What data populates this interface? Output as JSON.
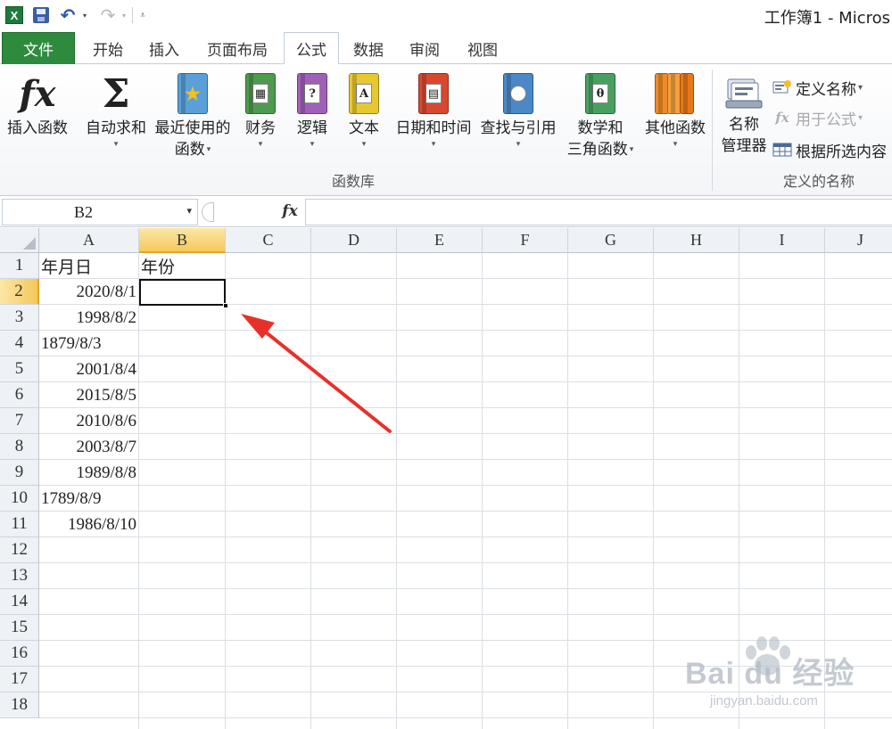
{
  "window": {
    "title": "工作簿1 - Micros"
  },
  "quick_access": {
    "app_icon": "excel-icon",
    "save_icon": "save-icon",
    "undo_icon": "undo-icon",
    "redo_icon": "redo-icon",
    "undo_glyph": "↶",
    "redo_glyph": "↷",
    "dd_glyph": "▾",
    "customize_glyph": "⩡",
    "app_glyph": "X"
  },
  "tabs": [
    {
      "label": "文件"
    },
    {
      "label": "开始"
    },
    {
      "label": "插入"
    },
    {
      "label": "页面布局"
    },
    {
      "label": "公式",
      "active": true
    },
    {
      "label": "数据"
    },
    {
      "label": "审阅"
    },
    {
      "label": "视图"
    }
  ],
  "ribbon": {
    "function_library": {
      "label": "函数库",
      "buttons": [
        {
          "label": "插入函数",
          "icon": "insert-function-icon",
          "glyph": "fx"
        },
        {
          "label": "自动求和",
          "icon": "sigma-icon",
          "glyph": "Σ"
        },
        {
          "label": "最近使用的",
          "label2": "函数",
          "icon": "recently-used-icon",
          "glyph": "★",
          "color": "#5aa0d8"
        },
        {
          "label": "财务",
          "icon": "financial-icon",
          "glyph": "▦",
          "color": "#4e9a4e"
        },
        {
          "label": "逻辑",
          "icon": "logical-icon",
          "glyph": "?",
          "color": "#a060b8"
        },
        {
          "label": "文本",
          "icon": "text-icon",
          "glyph": "A",
          "color": "#e8c830"
        },
        {
          "label": "日期和时间",
          "icon": "date-time-icon",
          "glyph": "▤",
          "color": "#d84830"
        },
        {
          "label": "查找与引用",
          "icon": "lookup-reference-icon",
          "glyph": "🔍",
          "color": "#4a88c8"
        },
        {
          "label": "数学和",
          "label2": "三角函数",
          "icon": "math-trig-icon",
          "glyph": "θ",
          "color": "#48a060"
        },
        {
          "label": "其他函数",
          "icon": "more-functions-icon",
          "glyph": "",
          "color": "#f08a28"
        }
      ],
      "caret": "▾"
    },
    "defined_names": {
      "label": "定义的名称",
      "name_manager": {
        "label": "名称",
        "label2": "管理器",
        "icon": "name-manager-icon"
      },
      "items": [
        {
          "label": "定义名称",
          "icon": "define-name-icon",
          "caret": "▾",
          "enabled": true
        },
        {
          "label": "用于公式",
          "icon": "use-in-formula-icon",
          "caret": "▾",
          "enabled": false
        },
        {
          "label": "根据所选内容",
          "icon": "create-from-selection-icon",
          "enabled": true
        }
      ]
    }
  },
  "formula_bar": {
    "name_box": "B2",
    "fx_label": "fx",
    "formula": ""
  },
  "sheet": {
    "columns": [
      "A",
      "B",
      "C",
      "D",
      "E",
      "F",
      "G",
      "H",
      "I",
      "J"
    ],
    "selected_column": "B",
    "rows": [
      "1",
      "2",
      "3",
      "4",
      "5",
      "6",
      "7",
      "8",
      "9",
      "10",
      "11",
      "12",
      "13",
      "14",
      "15",
      "16",
      "17",
      "18"
    ],
    "selected_row": "2",
    "cells": {
      "A1": "年月日",
      "B1": "年份",
      "A2": "2020/8/1",
      "A3": "1998/8/2",
      "A4": "1879/8/3",
      "A5": "2001/8/4",
      "A6": "2015/8/5",
      "A7": "2010/8/6",
      "A8": "2003/8/7",
      "A9": "1989/8/8",
      "A10": "1789/8/9",
      "A11": "1986/8/10"
    },
    "active_cell": "B2"
  },
  "annotation": {
    "arrow_color": "#e8302a"
  },
  "watermark": {
    "text": "Bai du 经验",
    "sub": "jingyan.baidu.com"
  }
}
